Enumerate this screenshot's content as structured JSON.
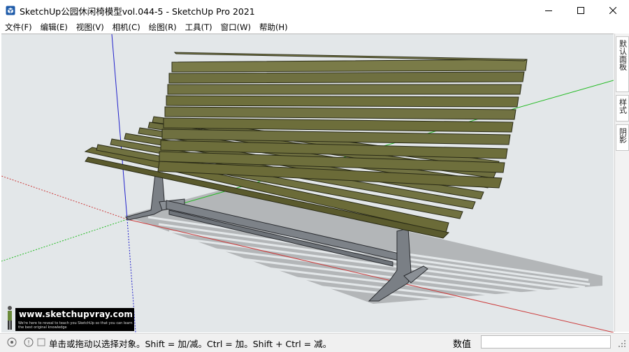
{
  "window": {
    "title": "SketchUp公园休闲椅模型vol.044-5 - SketchUp Pro 2021",
    "app_icon": "sketchup-logo-icon",
    "controls": [
      "minimize-icon",
      "maximize-icon",
      "close-icon"
    ]
  },
  "menu": [
    {
      "label": "文件(F)"
    },
    {
      "label": "编辑(E)"
    },
    {
      "label": "视图(V)"
    },
    {
      "label": "相机(C)"
    },
    {
      "label": "绘图(R)"
    },
    {
      "label": "工具(T)"
    },
    {
      "label": "窗口(W)"
    },
    {
      "label": "帮助(H)"
    }
  ],
  "tray": {
    "tabs": [
      "默认面板",
      "样式",
      "阴影"
    ]
  },
  "watermark": {
    "url": "www.sketchupvray.com",
    "tagline": "We're here to reveal to teach you SketchUp so that you can learn the best original knowledge"
  },
  "status": {
    "icons": [
      "geo-location-icon",
      "credits-icon",
      "info-icon"
    ],
    "hint": "单击或拖动以选择对象。Shift = 加/减。Ctrl = 加。Shift + Ctrl = 减。",
    "measure_label": "数值",
    "measure_value": ""
  },
  "colors": {
    "viewport_bg": "#e3e7e9",
    "slat": "#6b6b38",
    "slat_light": "#82844c",
    "frame": "#7a7f85",
    "shadow": "#b3b6b8",
    "axis_red": "#cc3a3a",
    "axis_green": "#22bb22",
    "axis_blue": "#2222cc"
  }
}
